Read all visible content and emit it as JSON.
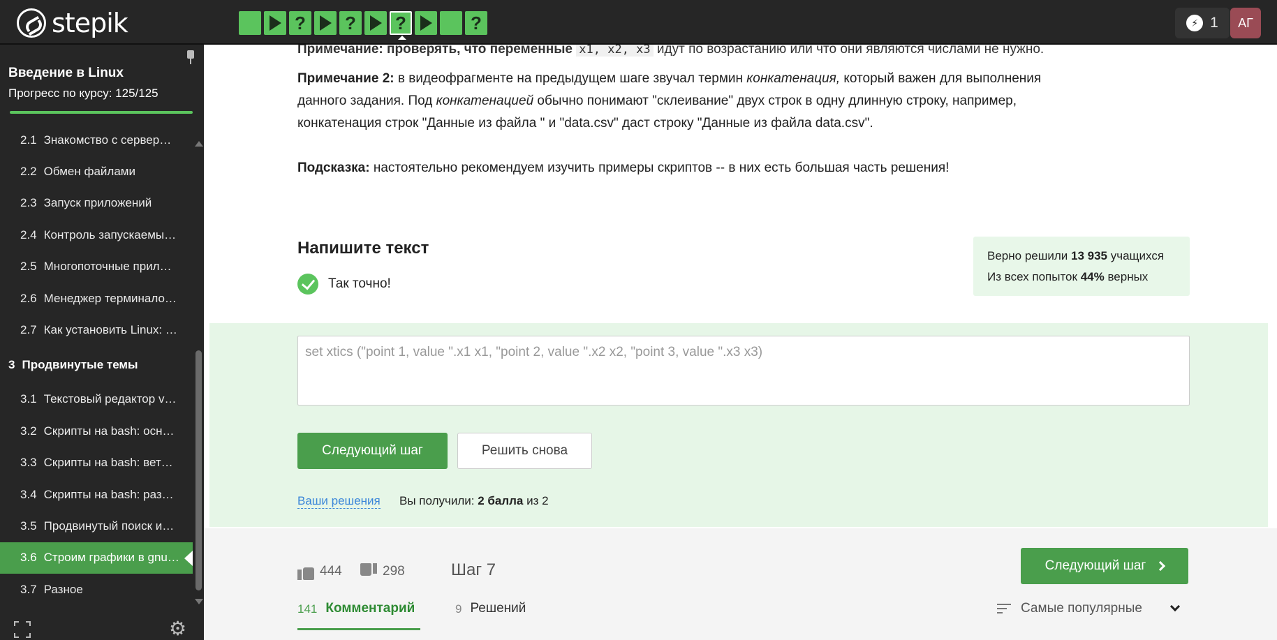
{
  "header": {
    "logo_text": "stepik",
    "steps": [
      {
        "kind": "blank"
      },
      {
        "kind": "play"
      },
      {
        "kind": "quiz",
        "label": "?"
      },
      {
        "kind": "play"
      },
      {
        "kind": "quiz",
        "label": "?"
      },
      {
        "kind": "play"
      },
      {
        "kind": "quiz",
        "label": "?",
        "active": true
      },
      {
        "kind": "play"
      },
      {
        "kind": "blank"
      },
      {
        "kind": "quiz",
        "label": "?"
      }
    ],
    "energy_count": "1",
    "avatar_initials": "АГ"
  },
  "sidebar": {
    "course_title": "Введение в Linux",
    "progress_label": "Прогресс по курсу:  125/125",
    "progress_fraction": 1.0,
    "items": [
      {
        "num": "2.1",
        "label": "Знакомство с сервер…"
      },
      {
        "num": "2.2",
        "label": "Обмен файлами"
      },
      {
        "num": "2.3",
        "label": "Запуск приложений"
      },
      {
        "num": "2.4",
        "label": "Контроль запускаемы…"
      },
      {
        "num": "2.5",
        "label": "Многопоточные прил…"
      },
      {
        "num": "2.6",
        "label": "Менеджер терминало…"
      },
      {
        "num": "2.7",
        "label": "Как установить Linux: …"
      },
      {
        "num": "3",
        "label": "Продвинутые темы",
        "section": true
      },
      {
        "num": "3.1",
        "label": "Текстовый редактор v…"
      },
      {
        "num": "3.2",
        "label": "Скрипты на bash: осн…"
      },
      {
        "num": "3.3",
        "label": "Скрипты на bash: вет…"
      },
      {
        "num": "3.4",
        "label": "Скрипты на bash: раз…"
      },
      {
        "num": "3.5",
        "label": "Продвинутый поиск и…"
      },
      {
        "num": "3.6",
        "label": "Строим графики в gnu…",
        "active": true
      },
      {
        "num": "3.7",
        "label": "Разное"
      }
    ]
  },
  "content": {
    "cut_line_part1": "Примечание: проверять, что переменные ",
    "cut_line_code": "x1, x2, x3",
    "cut_line_part2": " идут по возрастанию или что они являются числами не нужно.",
    "note2_label": "Примечание 2:",
    "note2_text_a": " в видеофрагменте на предыдущем шаге звучал термин ",
    "note2_term": "конкатенация,",
    "note2_text_b": " который важен для выполнения данного задания. Под ",
    "note2_term2": "конкатенацией",
    "note2_text_c": " обычно понимают \"склеивание\" двух строк в одну длинную строку, например, конкатенация строк \"Данные из файла \" и \"data.csv\" даст строку \"Данные из файла data.csv\".",
    "hint_label": "Подсказка:",
    "hint_text": " настоятельно рекомендуем изучить примеры скриптов -- в них есть большая часть решения!",
    "task_title": "Напишите текст",
    "result_text": "Так точно!",
    "stats_line1_a": "Верно решили ",
    "stats_line1_num": "13 935",
    "stats_line1_b": " учащихся",
    "stats_line2_a": "Из всех попыток ",
    "stats_line2_num": "44%",
    "stats_line2_b": " верных",
    "answer_text": "set xtics (\"point 1, value \".x1 x1, \"point 2, value \".x2 x2, \"point 3, value \".x3 x3)",
    "next_step_button": "Следующий шаг",
    "retry_button": "Решить снова",
    "your_solutions_link": "Ваши решения",
    "score_a": "Вы получили: ",
    "score_points": "2 балла",
    "score_b": " из 2"
  },
  "footer": {
    "likes": "444",
    "dislikes": "298",
    "step_label": "Шаг 7",
    "next_step_button": "Следующий шаг",
    "comments_count": "141",
    "comments_label": "Комментарий",
    "solutions_count": "9",
    "solutions_label": "Решений",
    "sort_label": "Самые популярные"
  }
}
